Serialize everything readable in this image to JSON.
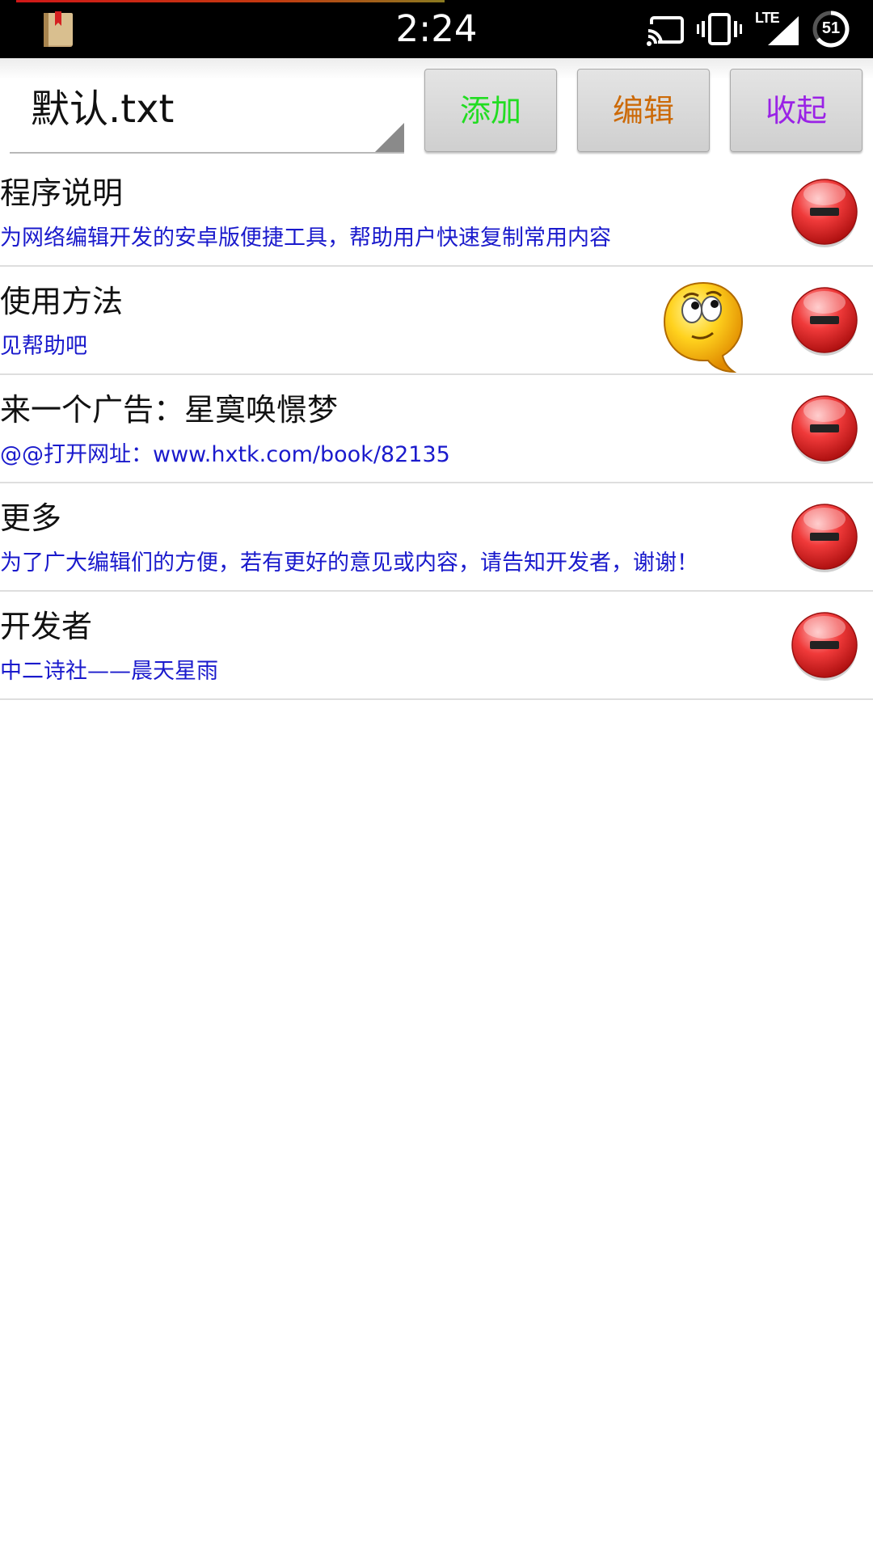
{
  "status_bar": {
    "time": "2:24",
    "network_label": "LTE",
    "battery_level": "51",
    "icons": [
      "book-app-icon",
      "cast-icon",
      "vibrate-icon",
      "lte-signal-icon",
      "battery-saver-icon"
    ]
  },
  "toolbar": {
    "file_name": "默认.txt",
    "add_label": "添加",
    "edit_label": "编辑",
    "collapse_label": "收起"
  },
  "colors": {
    "add": "#22dd22",
    "edit": "#cc6a08",
    "collapse": "#9a22e6",
    "content_text": "#1a1acc"
  },
  "items": [
    {
      "title": "程序说明",
      "content": "为网络编辑开发的安卓版便捷工具，帮助用户快速复制常用内容"
    },
    {
      "title": "使用方法",
      "content": "见帮助吧"
    },
    {
      "title": "来一个广告：星寞唤憬梦",
      "content": "@@打开网址：www.hxtk.com/book/82135"
    },
    {
      "title": "更多",
      "content": "为了广大编辑们的方便，若有更好的意见或内容，请告知开发者，谢谢！"
    },
    {
      "title": "开发者",
      "content": "中二诗社——晨天星雨"
    }
  ]
}
